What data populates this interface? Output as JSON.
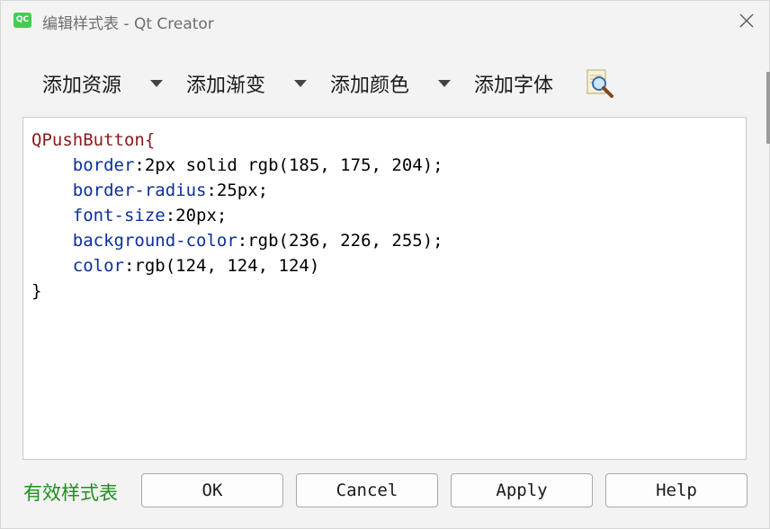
{
  "window": {
    "title": "编辑样式表 - Qt Creator",
    "app_icon_text": "QC",
    "accent_color": "#41cd52"
  },
  "toolbar": {
    "add_resource": "添加资源",
    "add_gradient": "添加渐变",
    "add_color": "添加颜色",
    "add_font": "添加字体",
    "find_icon": "magnifier-icon"
  },
  "editor": {
    "lines": [
      {
        "a": "QPushButton{",
        "b": "",
        "c": ""
      },
      {
        "a": "    ",
        "b": "border",
        "c": ":2px solid rgb(185, 175, 204);"
      },
      {
        "a": "    ",
        "b": "border-radius",
        "c": ":25px;"
      },
      {
        "a": "    ",
        "b": "font-size",
        "c": ":20px;"
      },
      {
        "a": "    ",
        "b": "background-color",
        "c": ":rgb(236, 226, 255);"
      },
      {
        "a": "    ",
        "b": "color",
        "c": ":rgb(124, 124, 124)"
      },
      {
        "a": "}",
        "b": "",
        "c": ""
      }
    ],
    "colors": {
      "selector": "#8b1a1a",
      "property": "#0b2f9c"
    }
  },
  "footer": {
    "status": "有效样式表",
    "status_color": "#1e8f1e",
    "ok": "OK",
    "cancel": "Cancel",
    "apply": "Apply",
    "help": "Help"
  }
}
